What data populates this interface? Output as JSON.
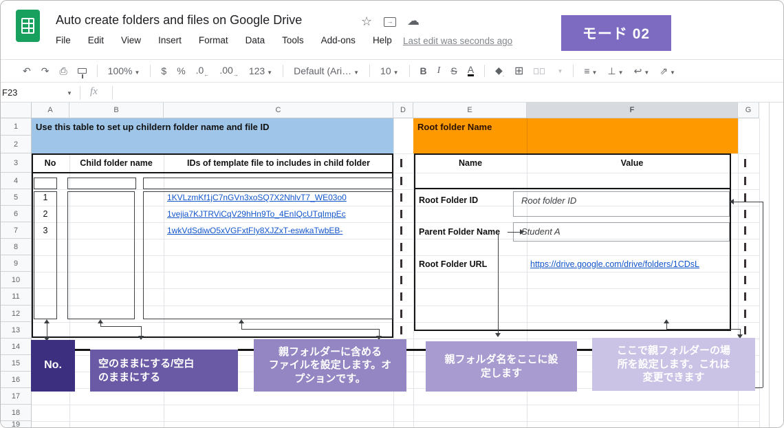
{
  "window": {
    "title": "Auto create folders and files on Google Drive",
    "mode_badge": "モード 02",
    "mode_badge_color": "#7d6bc2"
  },
  "menu": {
    "items": [
      "File",
      "Edit",
      "View",
      "Insert",
      "Format",
      "Data",
      "Tools",
      "Add-ons",
      "Help"
    ],
    "last_edit": "Last edit was seconds ago"
  },
  "toolbar": {
    "zoom": "100%",
    "currency": "$",
    "percent": "%",
    "dec_decrease": ".0",
    "dec_increase": ".00",
    "more_formats": "123",
    "font": "Default (Ari…",
    "font_size": "10",
    "bold": "B",
    "italic": "I",
    "strikethrough": "S",
    "text_color": "A"
  },
  "formula_bar": {
    "cell_ref": "F23",
    "fx_label": "fx"
  },
  "grid": {
    "column_labels": [
      "A",
      "B",
      "C",
      "D",
      "E",
      "F",
      "G"
    ],
    "selected_column": "F",
    "row_labels": [
      "1",
      "2",
      "3",
      "4",
      "5",
      "6",
      "7",
      "8",
      "9",
      "10",
      "11",
      "12",
      "13",
      "14",
      "15",
      "16",
      "17",
      "18",
      "19"
    ],
    "separator_glyph": "|"
  },
  "left_table": {
    "banner": "Use this table to set up childern folder name and file ID",
    "banner_color": "#9fc5e8",
    "headers": [
      "No",
      "Child folder name",
      "IDs of template file to includes in child folder"
    ],
    "rows": [
      {
        "no": "1",
        "link": "1KVLzmKf1jC7nGVn3xoSQ7X2NhlvT7_WE03o0"
      },
      {
        "no": "2",
        "link": "1vejia7KJTRViCqV29hHn9To_4EnIQcUTqImpEc"
      },
      {
        "no": "3",
        "link": "1wkVdSdiwO5xVGFxtFIy8XJZxT-eswkaTwbEB-"
      }
    ]
  },
  "right_table": {
    "banner": "Root folder Name",
    "banner_color": "#ff9900",
    "headers": [
      "Name",
      "Value"
    ],
    "rows": [
      {
        "name": "Root Folder ID",
        "value": "Root folder ID"
      },
      {
        "name": "Parent Folder Name",
        "value": "Student A"
      },
      {
        "name": "Root Folder URL",
        "value": "https://drive.google.com/drive/folders/1CDsL"
      }
    ]
  },
  "annotations": [
    {
      "text": "No.",
      "color": "#3d2f80"
    },
    {
      "text": "空のままにする/空白\nのままにする",
      "color": "#6a5aa6"
    },
    {
      "text": "親フォルダーに含める\nファイルを設定します。オ\nプションです。",
      "color": "#9386c3"
    },
    {
      "text": "親フォルダ名をここに設\n定します",
      "color": "#a89bd0"
    },
    {
      "text": "ここで親フォルダーの場\n所を設定します。これは\n変更できます",
      "color": "#cac3e5"
    }
  ],
  "colors": {
    "link": "#1155cc",
    "selected_column_header": "#d7dade",
    "table_border": "#141414",
    "gridline": "#e0e3e7"
  }
}
